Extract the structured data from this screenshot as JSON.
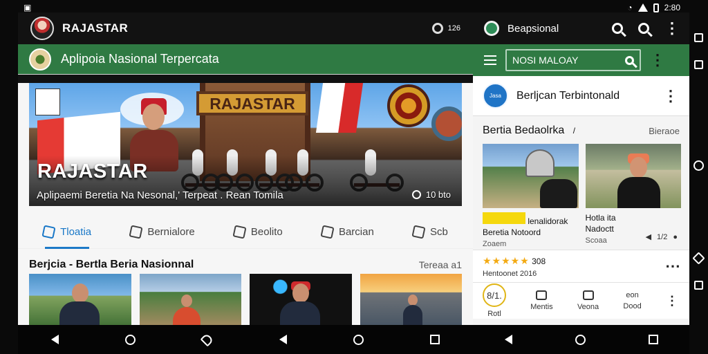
{
  "status": {
    "time": "2:80",
    "left_icon": "gallery-icon"
  },
  "left": {
    "app_title": "RAJASTAR",
    "counter": "126",
    "green_title": "Aplipoia Nasional Terpercata",
    "hero": {
      "poster_text": "",
      "banner": "RAJASTAR",
      "title": "RAJASTAR",
      "subtitle": "Aplipaemi Beretia Na Nesonal,' Terpeat . Rean Tomila",
      "count": "10 bto"
    },
    "tabs": [
      {
        "label": "Tloatia",
        "icon": "thumb-up-icon",
        "active": true
      },
      {
        "label": "Bernialore",
        "icon": "chat-icon",
        "active": false
      },
      {
        "label": "Beolito",
        "icon": "share-icon",
        "active": false
      },
      {
        "label": "Barcian",
        "icon": "share-icon",
        "active": false
      },
      {
        "label": "Scb",
        "icon": "share-icon",
        "active": false
      }
    ],
    "section": {
      "title": "Berjcia - Bertla Beria Nasionnal",
      "more": "Tereaa a1"
    }
  },
  "right": {
    "app_title": "Beapsional",
    "search_value": "NOSI MALOAY",
    "profile_title": "Berljcan Terbintonald",
    "profile_logo_text": "Jasa",
    "section_title": "Bertia Bedaolrka",
    "section_mark": "/",
    "section_category": "Bieraoe",
    "cards": [
      {
        "chip": "",
        "line1": "lenalidorak",
        "name": "Beretia Notoord",
        "small": "Zoaem"
      },
      {
        "chip": "",
        "line1": "Hotla ita",
        "name": "Nadoctt",
        "small": "Scoaa",
        "tool": "1/2"
      }
    ],
    "rating": {
      "stars": "★★★★★",
      "value": "308",
      "sub": "Hentoonet",
      "sub_value": "2016"
    },
    "nav": [
      {
        "label": "Rotl",
        "top": "8/1."
      },
      {
        "label": "Mentis",
        "top": ""
      },
      {
        "label": "Veona",
        "top": ""
      },
      {
        "label": "Dood",
        "top": "eon"
      }
    ]
  },
  "colors": {
    "green": "#2f7a43",
    "blue": "#1877c7",
    "star": "#f3aa13",
    "dark": "#121212"
  }
}
